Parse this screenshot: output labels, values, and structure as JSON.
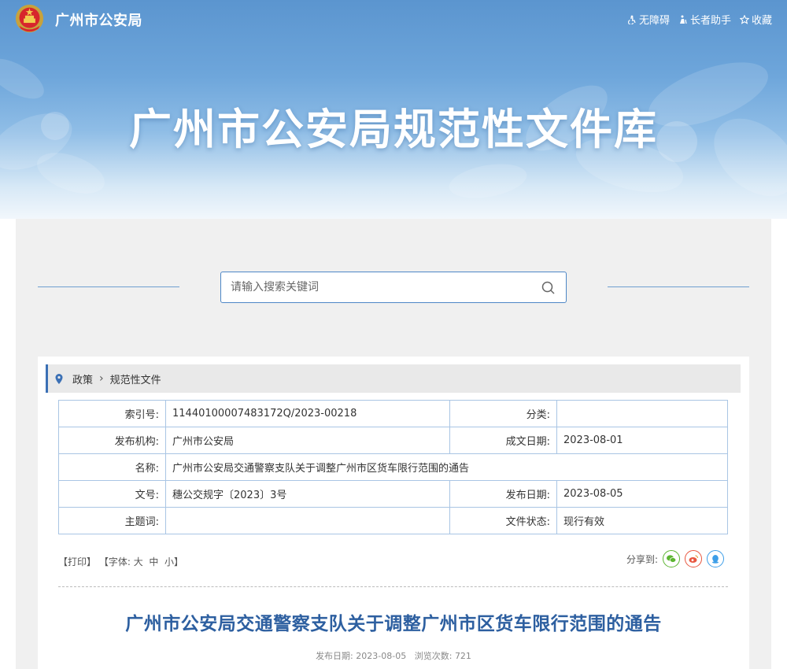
{
  "header": {
    "site_name": "广州市公安局",
    "links": [
      {
        "label": "无障碍",
        "icon": "accessibility-icon"
      },
      {
        "label": "长者助手",
        "icon": "elder-assistant-icon"
      },
      {
        "label": "收藏",
        "icon": "star-icon"
      }
    ],
    "banner_title": "广州市公安局规范性文件库"
  },
  "search": {
    "placeholder": "请输入搜索关键词",
    "icon": "search-icon"
  },
  "breadcrumb": {
    "items": [
      "政策",
      "规范性文件"
    ]
  },
  "meta_table": {
    "rows": [
      {
        "label1": "索引号:",
        "value1": "11440100007483172Q/2023-00218",
        "label2": "分类:",
        "value2": ""
      },
      {
        "label1": "发布机构:",
        "value1": "广州市公安局",
        "label2": "成文日期:",
        "value2": "2023-08-01"
      },
      {
        "label1": "名称:",
        "value1": "广州市公安局交通警察支队关于调整广州市区货车限行范围的通告"
      },
      {
        "label1": "文号:",
        "value1": "穗公交规字〔2023〕3号",
        "label2": "发布日期:",
        "value2": "2023-08-05"
      },
      {
        "label1": "主题词:",
        "value1": "",
        "label2": "文件状态:",
        "value2": "现行有效"
      }
    ]
  },
  "tools": {
    "print": "【打印】",
    "font_prefix": "【字体:",
    "font_large": "大",
    "font_medium": "中",
    "font_small": "小",
    "font_suffix": "】"
  },
  "share": {
    "label": "分享到:",
    "targets": [
      {
        "name": "wechat",
        "icon": "wechat-icon",
        "color": "#5cb531"
      },
      {
        "name": "weibo",
        "icon": "weibo-icon",
        "color": "#e8563f"
      },
      {
        "name": "qq",
        "icon": "qq-icon",
        "color": "#3d9ee8"
      }
    ]
  },
  "document": {
    "title": "广州市公安局交通警察支队关于调整广州市区货车限行范围的通告",
    "publish_label": "发布日期:",
    "publish_date": "2023-08-05",
    "views_label": "浏览次数:",
    "views": "721"
  },
  "colors": {
    "accent": "#3b70b5",
    "title": "#2d5fa0",
    "table_border": "#a9c5e4"
  }
}
